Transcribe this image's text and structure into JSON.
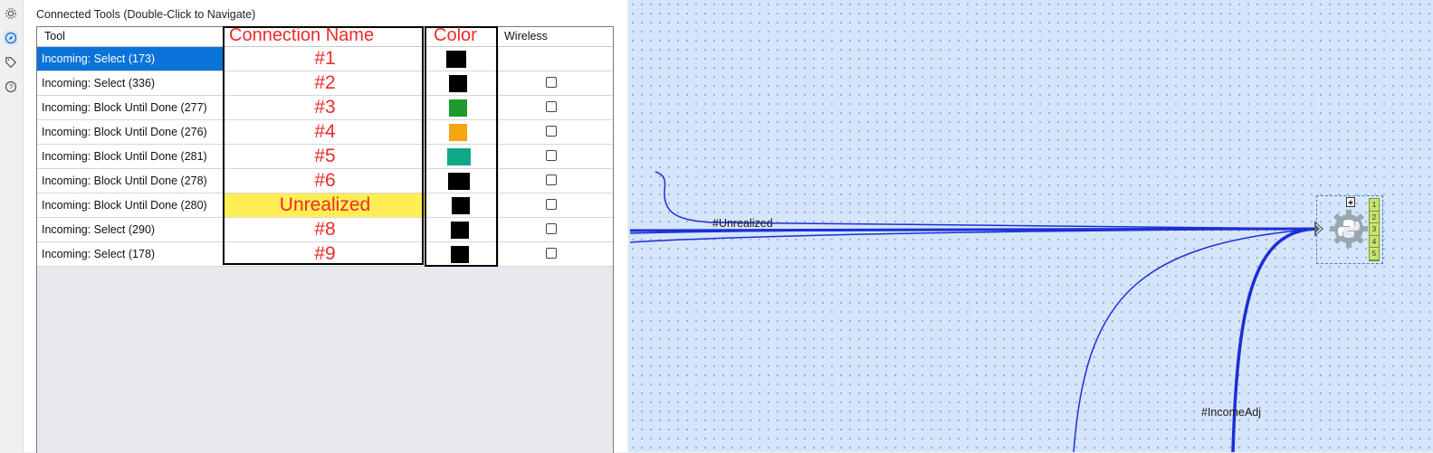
{
  "rail": {
    "icons": [
      "gear-icon",
      "compass-icon",
      "tag-icon",
      "help-icon"
    ]
  },
  "panel": {
    "title": "Connected Tools (Double-Click to Navigate)",
    "columns": {
      "tool": "Tool",
      "connection_name": "Connection Name",
      "color": "Color",
      "wireless": "Wireless"
    },
    "rows": [
      {
        "tool": "Incoming: Select (173)",
        "name": "#1",
        "color": "#000000",
        "wireless": false,
        "selected": true
      },
      {
        "tool": "Incoming: Select (336)",
        "name": "#2",
        "color": "#000000",
        "wireless": false
      },
      {
        "tool": "Incoming: Block Until Done (277)",
        "name": "#3",
        "color": "#1f9a2e",
        "wireless": false
      },
      {
        "tool": "Incoming: Block Until Done (276)",
        "name": "#4",
        "color": "#f5a50f",
        "wireless": false
      },
      {
        "tool": "Incoming: Block Until Done (281)",
        "name": "#5",
        "color": "#11a88a",
        "wireless": false
      },
      {
        "tool": "Incoming: Block Until Done (278)",
        "name": "#6",
        "color": "#000000",
        "wireless": false
      },
      {
        "tool": "Incoming: Block Until Done (280)",
        "name": "Unrealized",
        "color": "#000000",
        "wireless": false,
        "highlight": true
      },
      {
        "tool": "Incoming: Select (290)",
        "name": "#8",
        "color": "#000000",
        "wireless": false
      },
      {
        "tool": "Incoming: Select (178)",
        "name": "#9",
        "color": "#000000",
        "wireless": false
      }
    ]
  },
  "canvas": {
    "label_unrealized": "#Unrealized",
    "label_incomeadj": "#IncomeAdj",
    "tool_icon": "python-gear-icon",
    "bolt_icon": "bolt-icon",
    "input_anchors": [
      "1",
      "2",
      "3",
      "4",
      "5"
    ],
    "wire_color": "#1b2fd6"
  }
}
